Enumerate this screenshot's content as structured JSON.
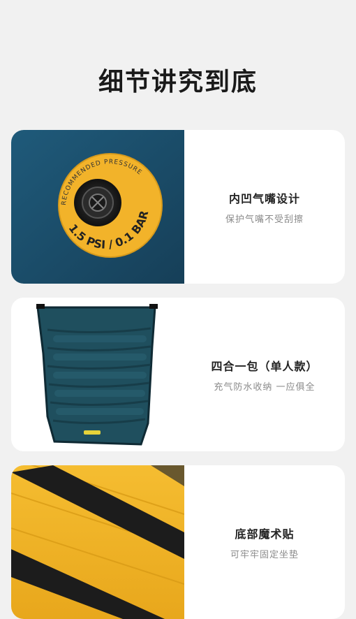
{
  "page": {
    "title": "细节讲究到底"
  },
  "cards": [
    {
      "title": "内凹气嘴设计",
      "subtitle": "保护气嘴不受刮擦",
      "badge_top_text": "RECOMMENDED PRESSURE",
      "badge_bottom_text": "1.5 PSI / 0.1 BAR"
    },
    {
      "title": "四合一包（单人款）",
      "subtitle": "充气防水收纳 一应俱全"
    },
    {
      "title": "底部魔术贴",
      "subtitle": "可牢牢固定坐垫"
    }
  ],
  "colors": {
    "teal": "#1e5372",
    "yellow": "#f2b32a",
    "mat_teal": "#1f4f5e",
    "background": "#f1f1f1"
  },
  "icons": [
    "valve-icon"
  ]
}
